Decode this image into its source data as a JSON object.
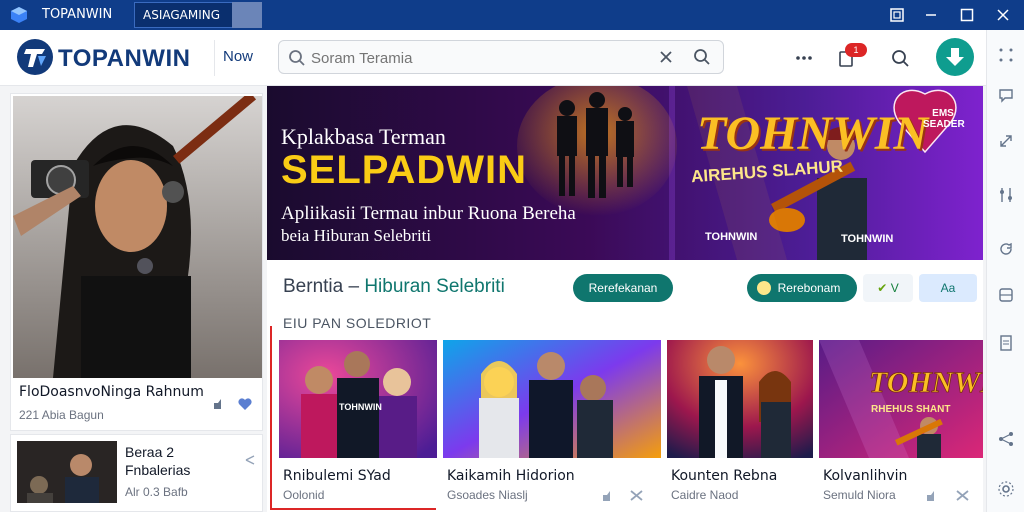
{
  "window": {
    "title": "TOPANWIN",
    "tab": "ASIAGAMING",
    "controls": [
      "restore-icon",
      "minimize-icon",
      "maximize-icon",
      "close-icon"
    ]
  },
  "header": {
    "brand": "TOPANWIN",
    "nav_link": "Now",
    "search": {
      "placeholder": "Soram Teramia"
    },
    "notification_count": "1"
  },
  "featured": {
    "title": "FloDoasnvoNinga Rahnum",
    "meta": "221 Abia Bagun"
  },
  "sidebar_item": {
    "title": "Beraa 2\nFnbalerias",
    "meta": "Alr 0.3 Bafb"
  },
  "banner": {
    "kicker": "Kplakbasa Terman",
    "title": "SELPADWIN",
    "subtitle_line1": "Apliikasii Termau inbur Ruona Bereha",
    "subtitle_line2": "beia Hiburan Selebriti",
    "brand": "TOHNWIN",
    "brand_sub": "AIREHUS SLAHUR",
    "badge_left": "TOHNWIN",
    "badge_right": "TOHNWIN",
    "heart_text": "EMS SEADER"
  },
  "section": {
    "title_prefix": "Berntia",
    "title_sep": " – ",
    "title_accent": "Hiburan Selebriti",
    "sub_label": "EIU PAN SOLEDRIOT",
    "pill_primary": "Rerefekanan",
    "pill_secondary": "Rerebonam",
    "chip_1": "V",
    "chip_2": "Aa"
  },
  "videos": [
    {
      "title": "Rnibulemi SYad",
      "meta": "Oolonid",
      "thumb_label": "TOHNWIN"
    },
    {
      "title": "Kaikamih Hidorion",
      "meta": "Gsoades Niaslj"
    },
    {
      "title": "Kounten Rebna",
      "meta": "Caidre Naod"
    },
    {
      "title": "Kolvanlihvin",
      "meta": "Semuld Niora",
      "thumb_label": "TOHNWIN",
      "thumb_sub": "RHEHUS SHANT"
    }
  ],
  "colors": {
    "titlebar": "#0f3d8a",
    "brand": "#123a7a",
    "accent_teal": "#0f9d8f",
    "banner_yellow": "#facc15",
    "selection": "#dc2626"
  }
}
